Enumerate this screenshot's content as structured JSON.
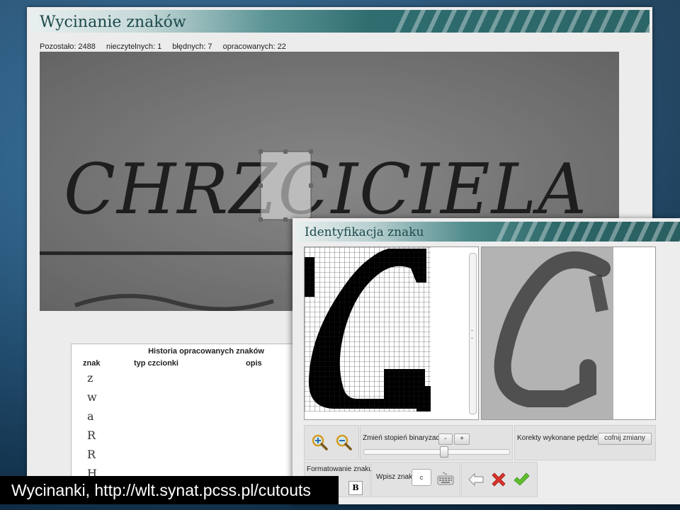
{
  "main_window": {
    "title": "Wycinanie znaków",
    "stats": {
      "remaining": "Pozostało: 2488",
      "unreadable": "nieczytelnych: 1",
      "errors": "błędnych: 7",
      "processed": "opracowanych: 22"
    },
    "scan_text": "CHRZCICIELA",
    "history": {
      "title": "Historia opracowanych znaków",
      "columns": [
        "znak",
        "typ czcionki",
        "opis"
      ],
      "rows": [
        "z",
        "w",
        "a",
        "R",
        "R",
        "H"
      ]
    }
  },
  "dialog": {
    "title": "Identyfikacja znaku",
    "zoom_in_icon": "zoom-in-icon",
    "zoom_out_icon": "zoom-out-icon",
    "binarization_label": "Zmień stopień binaryzacji",
    "binarization_minus": "-",
    "binarization_plus": "+",
    "binarization_level": 0.55,
    "brush_label": "Korekty wykonane pędzlem",
    "undo_label": "cofnij zmiany",
    "format_label": "Formatowanie znaku:",
    "bold_label": "B",
    "input_label": "Wpisz znak:",
    "input_value": "c",
    "keyboard_icon": "keyboard-icon",
    "back_icon": "arrow-left-icon",
    "reject_icon": "red-x-icon",
    "accept_icon": "green-check-icon"
  },
  "caption": {
    "text": "Wycinanki, http://wlt.synat.pcss.pl/cutouts"
  }
}
